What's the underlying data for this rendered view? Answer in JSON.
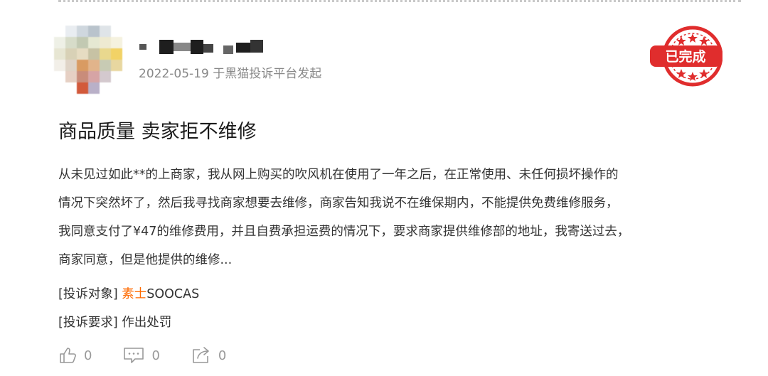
{
  "post": {
    "date_source": "2022-05-19 于黑猫投诉平台发起",
    "status_badge": "已完成",
    "title": "商品质量 卖家拒不维修",
    "body_lines": [
      "从未见过如此**的上商家，我从网上购买的吹风机在使用了一年之后，在正常使用、未任何损坏操作的",
      "情况下突然坏了，然后我寻找商家想要去维修，商家告知我说不在维保期内，不能提供免费维修服务，",
      "我同意支付了¥47的维修费用，并且自费承担运费的情况下，要求商家提供维修部的地址，我寄送过去，",
      "商家同意，但是他提供的维修..."
    ],
    "target_label": "[投诉对象]",
    "target_value_highlight": "素士",
    "target_value_rest": "SOOCAS",
    "demand_label": "[投诉要求]",
    "demand_value": "作出处罚"
  },
  "actions": {
    "like_count": "0",
    "comment_count": "0",
    "share_count": "0"
  },
  "colors": {
    "badge_red": "#e02d2d",
    "brand_orange": "#ff6a00",
    "meta_gray": "#888888"
  },
  "icons": [
    "avatar",
    "like-icon",
    "comment-icon",
    "share-icon",
    "completed-stamp"
  ]
}
